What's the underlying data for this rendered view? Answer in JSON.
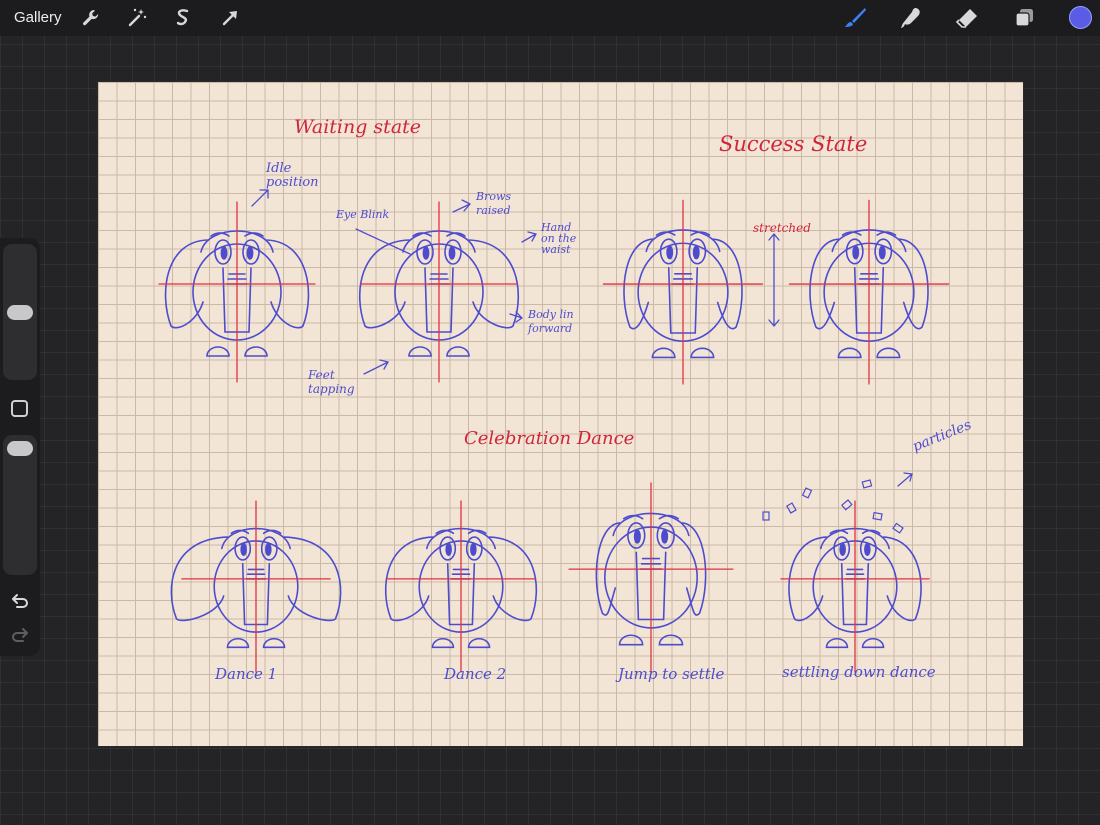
{
  "toolbar": {
    "gallery_label": "Gallery",
    "left_tools": [
      "wrench-icon",
      "magic-wand-icon",
      "selection-icon",
      "transform-arrow-icon"
    ],
    "right_tools": [
      "brush-icon",
      "smudge-icon",
      "eraser-icon",
      "layers-icon"
    ],
    "active_color": "#5b5ce6"
  },
  "sidebar": {
    "controls": [
      "brush-size-slider",
      "modify-button",
      "opacity-slider",
      "undo-icon",
      "redo-icon"
    ]
  },
  "canvas": {
    "paper_color": "#f3e5d5",
    "ink_color": "#4d4ccf",
    "guide_color": "#e2323f",
    "sections": {
      "waiting": "Waiting state",
      "success": "Success State",
      "celebration": "Celebration Dance"
    },
    "notes": {
      "idle": "Idle\nposition",
      "eye_blink": "Eye Blink",
      "brows": "Brows\nraised",
      "hand": "Hand\non the\nwaist",
      "body": "Body lin\nforward",
      "feet": "Feet\ntapping",
      "stretched": "stretched",
      "particles": "particles"
    },
    "captions": [
      "Dance 1",
      "Dance 2",
      "Jump to settle",
      "settling down dance"
    ]
  }
}
